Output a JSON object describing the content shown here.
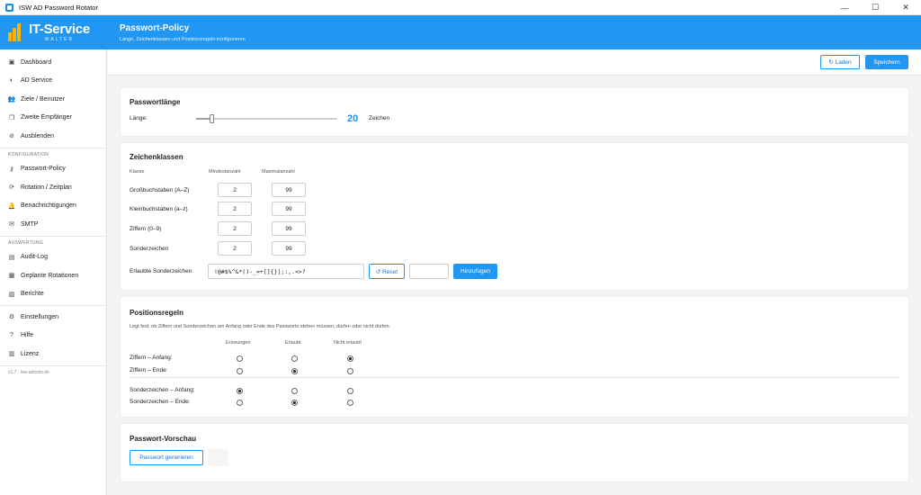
{
  "window": {
    "title": "ISW AD Password Rotator",
    "controls": [
      "—",
      "☐",
      "✕"
    ]
  },
  "logo": {
    "text": "IT-Service",
    "subtext": "WALTER"
  },
  "header": {
    "title": "Passwort-Policy",
    "subtitle": "Länge, Zeichenklassen und Positionsregeln konfigurieren"
  },
  "sidebar": {
    "group1": [
      {
        "label": "Dashboard",
        "icon": "dashboard-icon",
        "glyph": "▣"
      },
      {
        "label": "AD Service",
        "icon": "half-circle-icon",
        "glyph": "◐"
      },
      {
        "label": "Ziele / Benutzer",
        "icon": "users-icon",
        "glyph": "👥"
      },
      {
        "label": "Zweite Empfänger",
        "icon": "copy-icon",
        "glyph": "❐"
      },
      {
        "label": "Ausblenden",
        "icon": "hide-icon",
        "glyph": "⊘"
      }
    ],
    "section2": "KONFIGURATION",
    "group2": [
      {
        "label": "Passwort-Policy",
        "icon": "key-icon",
        "glyph": "⚷"
      },
      {
        "label": "Rotation / Zeitplan",
        "icon": "rotation-icon",
        "glyph": "⟳"
      },
      {
        "label": "Benachrichtigungen",
        "icon": "bell-icon",
        "glyph": "🔔"
      },
      {
        "label": "SMTP",
        "icon": "mail-icon",
        "glyph": "✉"
      }
    ],
    "section3": "AUSWERTUNG",
    "group3": [
      {
        "label": "Audit-Log",
        "icon": "log-icon",
        "glyph": "▤"
      },
      {
        "label": "Geplante Rotationen",
        "icon": "calendar-icon",
        "glyph": "▦"
      },
      {
        "label": "Berichte",
        "icon": "report-icon",
        "glyph": "▧"
      }
    ],
    "group4": [
      {
        "label": "Einstellungen",
        "icon": "gear-icon",
        "glyph": "⚙"
      },
      {
        "label": "Hilfe",
        "icon": "help-icon",
        "glyph": "?"
      },
      {
        "label": "Lizenz",
        "icon": "license-icon",
        "glyph": "▥"
      }
    ],
    "version": "v1.7 · isw-adtools.de"
  },
  "toolbar": {
    "load_label": "↻ Laden",
    "save_label": "Speichern"
  },
  "length": {
    "title": "Passwortlänge",
    "label": "Länge:",
    "value": "20",
    "unit": "Zeichen",
    "slider_fraction": 0.11
  },
  "classes": {
    "title": "Zeichenklassen",
    "col_class": "Klasse",
    "col_min": "Mindestanzahl",
    "col_max": "Maximalanzahl",
    "rows": [
      {
        "label": "Großbuchstaben (A–Z)",
        "min": "2",
        "max": "99"
      },
      {
        "label": "Kleinbuchstaben (a–z)",
        "min": "2",
        "max": "99"
      },
      {
        "label": "Ziffern (0–9)",
        "min": "2",
        "max": "99"
      },
      {
        "label": "Sonderzeichen",
        "min": "2",
        "max": "99"
      }
    ],
    "allowed_label": "Erlaubte Sonderzeichen",
    "allowed_value": "!@#$%^&*()-_=+[]{}|;:,.<>?",
    "reset_label": "↺ Reset",
    "add_label": "Hinzufügen"
  },
  "positions": {
    "title": "Positionsregeln",
    "description": "Legt fest, ob Ziffern und Sonderzeichen am Anfang oder Ende des Passworts stehen müssen, dürfen oder nicht dürfen.",
    "col_forced": "Erzwungen",
    "col_allowed": "Erlaubt",
    "col_forbidden": "Nicht erlaubt",
    "rows": [
      {
        "label": "Ziffern – Anfang:",
        "selected": 2
      },
      {
        "label": "Ziffern – Ende:",
        "selected": 1
      },
      {
        "label": "Sonderzeichen – Anfang:",
        "selected": 0
      },
      {
        "label": "Sonderzeichen – Ende:",
        "selected": 1
      }
    ]
  },
  "preview": {
    "title": "Passwort-Vorschau",
    "generate_label": "Passwort generieren"
  },
  "colors": {
    "accent": "#2196f3",
    "logo_bars": "#ffb300"
  }
}
